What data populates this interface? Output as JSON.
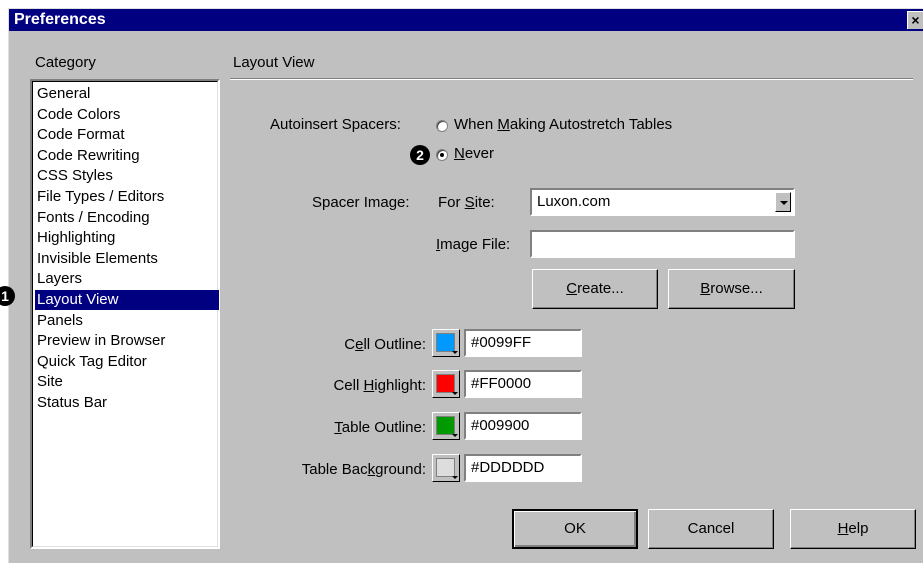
{
  "window": {
    "title": "Preferences",
    "close_glyph": "×"
  },
  "category": {
    "header": "Category",
    "items": [
      "General",
      "Code Colors",
      "Code Format",
      "Code Rewriting",
      "CSS Styles",
      "File Types / Editors",
      "Fonts / Encoding",
      "Highlighting",
      "Invisible Elements",
      "Layers",
      "Layout View",
      "Panels",
      "Preview in Browser",
      "Quick Tag Editor",
      "Site",
      "Status Bar"
    ],
    "selected": "Layout View"
  },
  "panel": {
    "title": "Layout View",
    "autoinsert_label": "Autoinsert Spacers:",
    "radio_autostretch": {
      "pre": "When ",
      "key": "M",
      "post": "aking Autostretch Tables",
      "checked": false
    },
    "radio_never": {
      "pre": "",
      "key": "N",
      "post": "ever",
      "checked": true
    },
    "spacer_image_label": "Spacer Image:",
    "for_site": {
      "pre": "For ",
      "key": "S",
      "post": "ite:"
    },
    "site_value": "Luxon.com",
    "image_file": {
      "pre": "",
      "key": "I",
      "post": "mage File:"
    },
    "image_file_value": "",
    "create_button": {
      "pre": "",
      "key": "C",
      "post": "reate..."
    },
    "browse_button": {
      "pre": "",
      "key": "B",
      "post": "rowse..."
    },
    "colors": [
      {
        "pre": "C",
        "key": "e",
        "post": "ll Outline:",
        "value": "#0099FF",
        "swatch": "#0099FF"
      },
      {
        "pre": "Cell ",
        "key": "H",
        "post": "ighlight:",
        "value": "#FF0000",
        "swatch": "#FF0000"
      },
      {
        "pre": "",
        "key": "T",
        "post": "able Outline:",
        "value": "#009900",
        "swatch": "#009900"
      },
      {
        "pre": "Table Bac",
        "key": "k",
        "post": "ground:",
        "value": "#DDDDDD",
        "swatch": "#DDDDDD"
      }
    ]
  },
  "buttons": {
    "ok": "OK",
    "cancel": "Cancel",
    "help": {
      "pre": "",
      "key": "H",
      "post": "elp"
    }
  },
  "callouts": {
    "one": "1",
    "two": "2"
  }
}
